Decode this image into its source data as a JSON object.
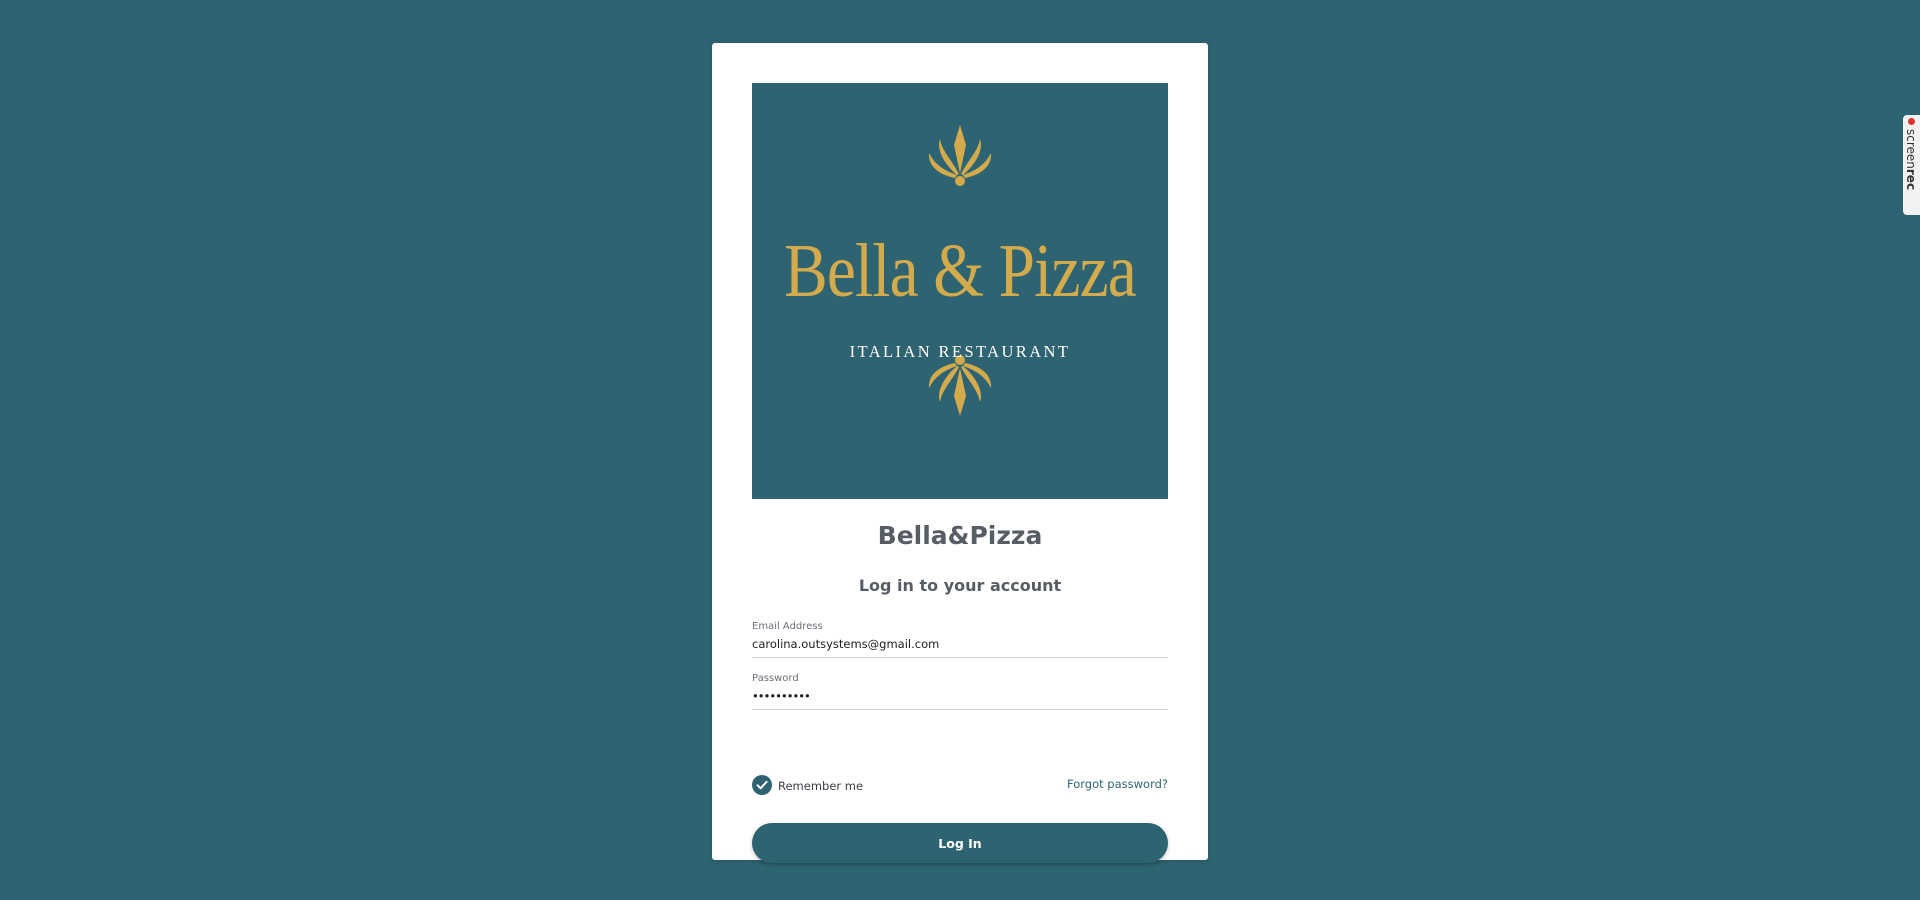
{
  "logo": {
    "name": "Bella & Pizza",
    "tagline": "ITALIAN RESTAURANT",
    "accent_color": "#d4ab4c",
    "background_color": "#2e6371"
  },
  "app": {
    "title": "Bella&Pizza",
    "subtitle": "Log in to your account"
  },
  "form": {
    "email": {
      "label": "Email Address",
      "value": "carolina.outsystems@gmail.com"
    },
    "password": {
      "label": "Password",
      "value": "••••••••••"
    },
    "remember": {
      "label": "Remember me",
      "checked": true
    },
    "forgot_label": "Forgot password?",
    "submit_label": "Log In"
  },
  "recorder_badge": {
    "text_light": "screen",
    "text_bold": "rec",
    "icons": [
      "record-dot-icon"
    ]
  },
  "colors": {
    "page_background": "#2e6371",
    "primary": "#2e6371",
    "text": "#565d64"
  }
}
